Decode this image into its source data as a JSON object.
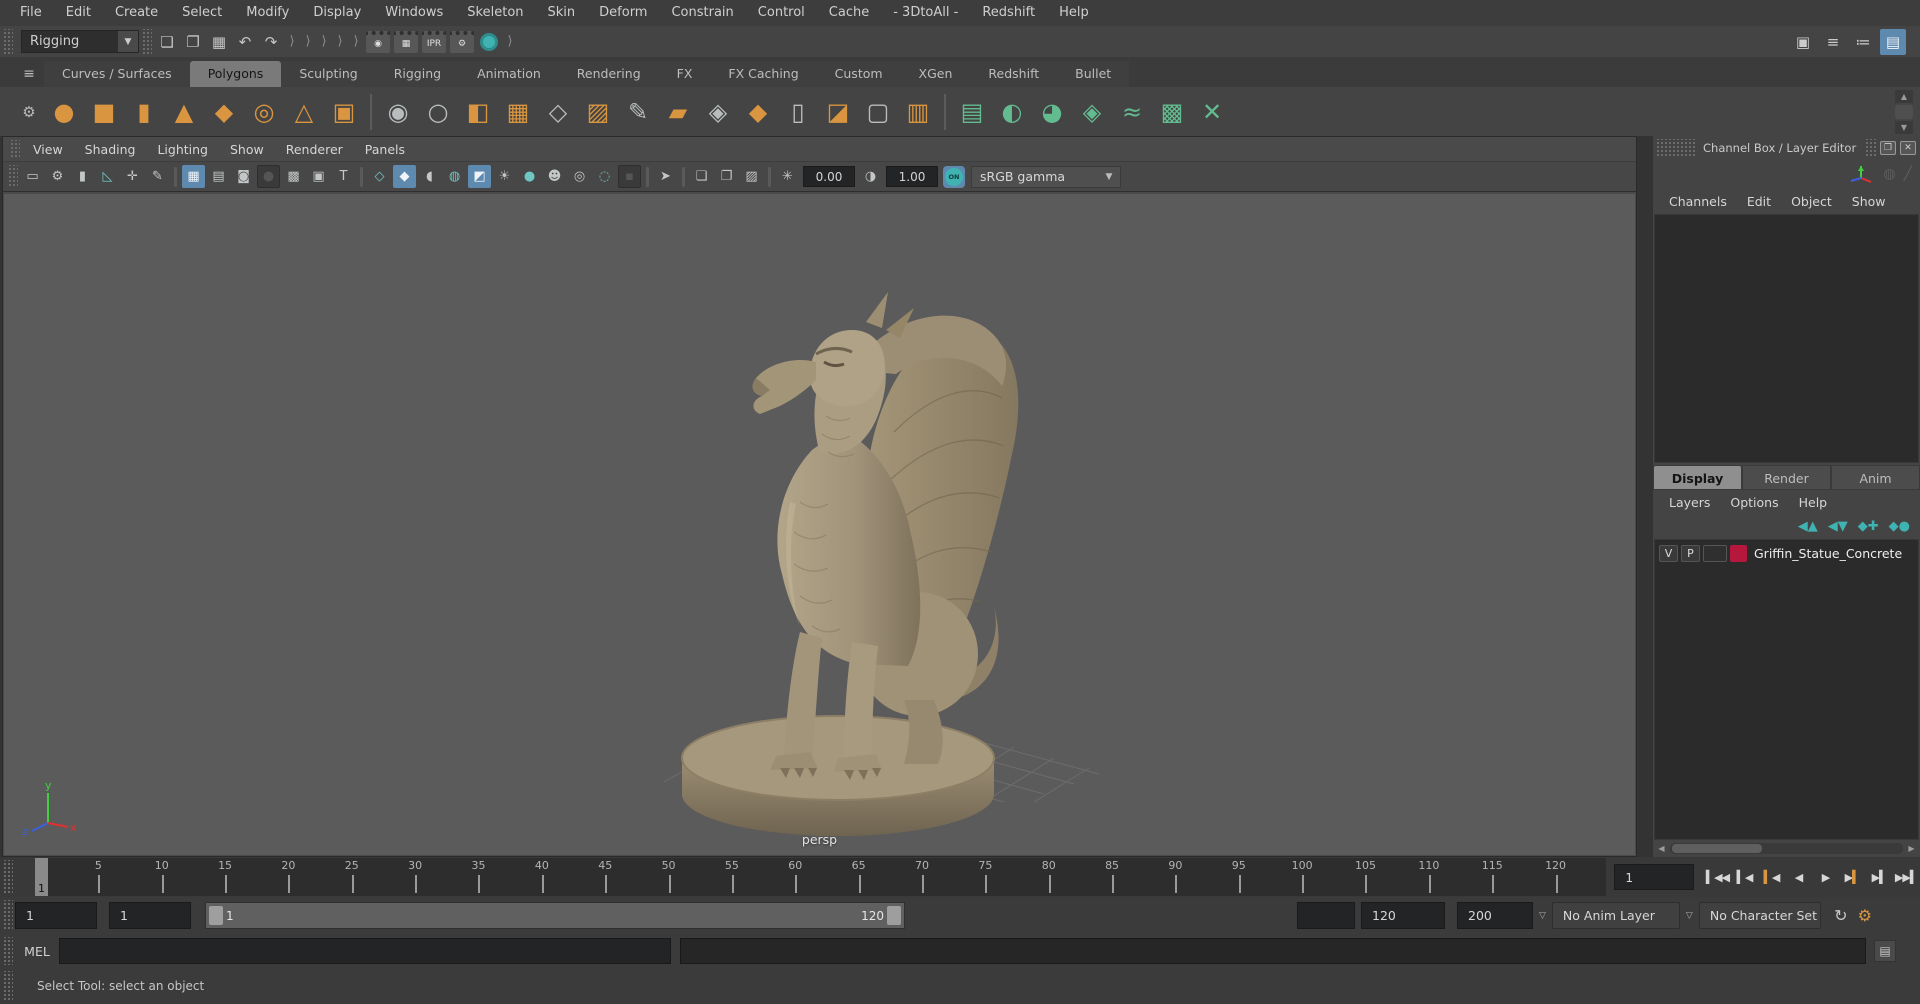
{
  "menu_bar": {
    "items": [
      {
        "name": "menu-file",
        "label": "File"
      },
      {
        "name": "menu-edit",
        "label": "Edit"
      },
      {
        "name": "menu-create",
        "label": "Create"
      },
      {
        "name": "menu-select",
        "label": "Select"
      },
      {
        "name": "menu-modify",
        "label": "Modify"
      },
      {
        "name": "menu-display",
        "label": "Display"
      },
      {
        "name": "menu-windows",
        "label": "Windows"
      },
      {
        "name": "menu-skeleton",
        "label": "Skeleton"
      },
      {
        "name": "menu-skin",
        "label": "Skin"
      },
      {
        "name": "menu-deform",
        "label": "Deform"
      },
      {
        "name": "menu-constrain",
        "label": "Constrain"
      },
      {
        "name": "menu-control",
        "label": "Control"
      },
      {
        "name": "menu-cache",
        "label": "Cache"
      },
      {
        "name": "menu-3dtoall",
        "label": "- 3DtoAll -"
      },
      {
        "name": "menu-redshift",
        "label": "Redshift"
      },
      {
        "name": "menu-help",
        "label": "Help"
      }
    ]
  },
  "status_line": {
    "menu_set": "Rigging",
    "menu_set_arrow": "▼",
    "file_icons": [
      {
        "name": "new-scene-icon",
        "glyph": "❏"
      },
      {
        "name": "open-scene-icon",
        "glyph": "❐"
      },
      {
        "name": "save-scene-icon",
        "glyph": "▦"
      },
      {
        "name": "undo-icon",
        "glyph": "↶"
      },
      {
        "name": "redo-icon",
        "glyph": "↷"
      }
    ],
    "collapsed_sections": [
      {
        "name": "collapsed-section-snap",
        "glyph": "⟩"
      },
      {
        "name": "collapsed-section-symmetry",
        "glyph": "⟩"
      },
      {
        "name": "collapsed-section-inputs",
        "glyph": "⟩"
      },
      {
        "name": "collapsed-section-construction",
        "glyph": "⟩"
      },
      {
        "name": "collapsed-section-history",
        "glyph": "⟩"
      }
    ],
    "render_icons": [
      {
        "name": "open-render-view-icon",
        "glyph": "◉"
      },
      {
        "name": "render-current-frame-icon",
        "glyph": "▦"
      },
      {
        "name": "ipr-render-icon",
        "glyph": "IPR"
      },
      {
        "name": "render-settings-icon",
        "glyph": "⚙"
      }
    ],
    "sidebar_toggles": [
      {
        "name": "modeling-toolkit-toggle",
        "glyph": "▣"
      },
      {
        "name": "attribute-editor-toggle",
        "glyph": "≡"
      },
      {
        "name": "tool-settings-toggle",
        "glyph": "≔"
      },
      {
        "name": "channel-box-toggle",
        "glyph": "▤",
        "active": true
      }
    ]
  },
  "shelf": {
    "tabs": [
      {
        "name": "shelf-tab-curves-surfaces",
        "label": "Curves / Surfaces"
      },
      {
        "name": "shelf-tab-polygons",
        "label": "Polygons",
        "active": true
      },
      {
        "name": "shelf-tab-sculpting",
        "label": "Sculpting"
      },
      {
        "name": "shelf-tab-rigging",
        "label": "Rigging"
      },
      {
        "name": "shelf-tab-animation",
        "label": "Animation"
      },
      {
        "name": "shelf-tab-rendering",
        "label": "Rendering"
      },
      {
        "name": "shelf-tab-fx",
        "label": "FX"
      },
      {
        "name": "shelf-tab-fx-caching",
        "label": "FX Caching"
      },
      {
        "name": "shelf-tab-custom",
        "label": "Custom"
      },
      {
        "name": "shelf-tab-xgen",
        "label": "XGen"
      },
      {
        "name": "shelf-tab-redshift",
        "label": "Redshift"
      },
      {
        "name": "shelf-tab-bullet",
        "label": "Bullet"
      }
    ],
    "primitives": [
      {
        "name": "poly-sphere-icon",
        "glyph": "●",
        "cls": "orange"
      },
      {
        "name": "poly-cube-icon",
        "glyph": "■",
        "cls": "orange"
      },
      {
        "name": "poly-cylinder-icon",
        "glyph": "▮",
        "cls": "orange"
      },
      {
        "name": "poly-cone-icon",
        "glyph": "▲",
        "cls": "orange"
      },
      {
        "name": "poly-plane-icon",
        "glyph": "◆",
        "cls": "orange"
      },
      {
        "name": "poly-torus-icon",
        "glyph": "◎",
        "cls": "orange"
      },
      {
        "name": "poly-pyramid-icon",
        "glyph": "△",
        "cls": "orange"
      },
      {
        "name": "poly-pipe-icon",
        "glyph": "▣",
        "cls": "orange"
      }
    ],
    "modeling": [
      {
        "name": "combine-icon",
        "glyph": "◉",
        "cls": "gray"
      },
      {
        "name": "separate-icon",
        "glyph": "○",
        "cls": "gray"
      },
      {
        "name": "mirror-icon",
        "glyph": "◧",
        "cls": "orange"
      },
      {
        "name": "smooth-icon",
        "glyph": "▦",
        "cls": "orange"
      },
      {
        "name": "smooth-mesh-preview-icon",
        "glyph": "◇",
        "cls": "gray"
      },
      {
        "name": "reduce-icon",
        "glyph": "▨",
        "cls": "orange"
      },
      {
        "name": "multi-cut-icon",
        "glyph": "✎",
        "cls": "gray"
      },
      {
        "name": "extrude-icon",
        "glyph": "▰",
        "cls": "orange"
      },
      {
        "name": "bevel-icon",
        "glyph": "◈",
        "cls": "gray"
      },
      {
        "name": "bridge-icon",
        "glyph": "◆",
        "cls": "orange"
      },
      {
        "name": "target-weld-icon",
        "glyph": "▯",
        "cls": "gray"
      },
      {
        "name": "quad-draw-icon",
        "glyph": "◪",
        "cls": "orange"
      },
      {
        "name": "edit-edge-flow-icon",
        "glyph": "▢",
        "cls": "gray"
      },
      {
        "name": "insert-edge-loop-icon",
        "glyph": "▥",
        "cls": "orange"
      }
    ],
    "uv": [
      {
        "name": "planar-mapping-icon",
        "glyph": "▤",
        "cls": "green"
      },
      {
        "name": "cylindrical-mapping-icon",
        "glyph": "◐",
        "cls": "green"
      },
      {
        "name": "spherical-mapping-icon",
        "glyph": "◕",
        "cls": "green"
      },
      {
        "name": "automatic-mapping-icon",
        "glyph": "◈",
        "cls": "green"
      },
      {
        "name": "contour-stretch-icon",
        "glyph": "≈",
        "cls": "green"
      },
      {
        "name": "uv-editor-icon",
        "glyph": "▩",
        "cls": "green"
      },
      {
        "name": "unfold-icon",
        "glyph": "✕",
        "cls": "green"
      }
    ]
  },
  "viewport": {
    "menus": [
      {
        "name": "vp-menu-view",
        "label": "View"
      },
      {
        "name": "vp-menu-shading",
        "label": "Shading"
      },
      {
        "name": "vp-menu-lighting",
        "label": "Lighting"
      },
      {
        "name": "vp-menu-show",
        "label": "Show"
      },
      {
        "name": "vp-menu-renderer",
        "label": "Renderer"
      },
      {
        "name": "vp-menu-panels",
        "label": "Panels"
      }
    ],
    "toolbar_g1": [
      {
        "name": "select-camera-icon",
        "glyph": "▭"
      },
      {
        "name": "camera-attributes-icon",
        "glyph": "⚙"
      },
      {
        "name": "bookmark-icon",
        "glyph": "▮"
      },
      {
        "name": "image-plane-icon",
        "glyph": "◺",
        "cls": "teal"
      },
      {
        "name": "pan-zoom-icon",
        "glyph": "✛"
      },
      {
        "name": "grease-pencil-icon",
        "glyph": "✎"
      }
    ],
    "toolbar_g2": [
      {
        "name": "grid-toggle-icon",
        "glyph": "▦",
        "active": true
      },
      {
        "name": "film-gate-icon",
        "glyph": "▤"
      },
      {
        "name": "resolution-gate-icon",
        "glyph": "◙"
      },
      {
        "name": "gate-mask-icon",
        "glyph": "●",
        "cls": "dark"
      },
      {
        "name": "field-chart-icon",
        "glyph": "▩"
      },
      {
        "name": "safe-action-icon",
        "glyph": "▣"
      },
      {
        "name": "safe-title-icon",
        "glyph": "T"
      }
    ],
    "toolbar_g3": [
      {
        "name": "wireframe-icon",
        "glyph": "◇",
        "cls": "teal"
      },
      {
        "name": "smooth-shade-icon",
        "glyph": "◆",
        "active": true
      },
      {
        "name": "flat-shade-icon",
        "glyph": "◖"
      },
      {
        "name": "textured-icon",
        "glyph": "◍",
        "cls": "teal"
      },
      {
        "name": "use-default-material-icon",
        "glyph": "◩",
        "active": true
      },
      {
        "name": "lights-icon",
        "glyph": "☀"
      },
      {
        "name": "shadows-icon",
        "glyph": "●",
        "cls": "teal"
      }
    ],
    "toolbar_g4": [
      {
        "name": "xray-icon",
        "glyph": "☻"
      },
      {
        "name": "xray-joints-icon",
        "glyph": "◎"
      },
      {
        "name": "xray-active-icon",
        "glyph": "◌",
        "cls": "teal"
      },
      {
        "name": "isolate-select-icon",
        "glyph": "▪",
        "cls": "dark"
      }
    ],
    "toolbar_g5": [
      {
        "name": "select-object-icon",
        "glyph": "➤"
      }
    ],
    "toolbar_g6": [
      {
        "name": "snapshot-copy-icon",
        "glyph": "❏"
      },
      {
        "name": "snapshot-paste-icon",
        "glyph": "❐"
      },
      {
        "name": "viewport-snapshot-icon",
        "glyph": "▨"
      }
    ],
    "exposure_icon": "✳",
    "exposure_value": "0.00",
    "gamma_icon": "◑",
    "gamma_value": "1.00",
    "on_label": "ON",
    "view_transform": "sRGB gamma",
    "view_transform_arrow": "▼",
    "camera_label": "persp",
    "axis_labels": {
      "x": "x",
      "y": "y",
      "z": "z"
    }
  },
  "channel_box": {
    "title": "Channel Box / Layer Editor",
    "float_glyph": "❐",
    "close_glyph": "✕",
    "menus": [
      {
        "name": "cb-menu-channels",
        "label": "Channels"
      },
      {
        "name": "cb-menu-edit",
        "label": "Edit"
      },
      {
        "name": "cb-menu-object",
        "label": "Object"
      },
      {
        "name": "cb-menu-show",
        "label": "Show"
      }
    ]
  },
  "layer_editor": {
    "tabs": [
      {
        "name": "layer-tab-display",
        "label": "Display",
        "active": true
      },
      {
        "name": "layer-tab-render",
        "label": "Render"
      },
      {
        "name": "layer-tab-anim",
        "label": "Anim"
      }
    ],
    "menus": [
      {
        "name": "layer-menu-layers",
        "label": "Layers"
      },
      {
        "name": "layer-menu-options",
        "label": "Options"
      },
      {
        "name": "layer-menu-help",
        "label": "Help"
      }
    ],
    "actions": [
      {
        "name": "move-layer-up-icon",
        "glyph": "◀▲"
      },
      {
        "name": "move-layer-down-icon",
        "glyph": "◀▼"
      },
      {
        "name": "create-empty-layer-icon",
        "glyph": "◆✚"
      },
      {
        "name": "create-layer-from-selected-icon",
        "glyph": "◆●"
      }
    ],
    "layers": [
      {
        "visible": "V",
        "playback": "P",
        "color": "#b5173d",
        "label": "Griffin_Statue_Concrete"
      }
    ],
    "hscroll": {
      "left": "◀",
      "right": "▶"
    }
  },
  "timeline": {
    "tick_labels": [
      5,
      10,
      15,
      20,
      25,
      30,
      35,
      40,
      45,
      50,
      55,
      60,
      65,
      70,
      75,
      80,
      85,
      90,
      95,
      100,
      105,
      110,
      115,
      120
    ],
    "view_end": 124,
    "playhead_frame": 1,
    "playhead_label": "1",
    "current_frame_field": "1",
    "playback": [
      {
        "name": "go-to-start-button",
        "pre": "▍",
        "tri": "◀◀",
        "post": ""
      },
      {
        "name": "step-back-frame-button",
        "pre": "▍",
        "tri": "◀",
        "post": ""
      },
      {
        "name": "step-back-key-button",
        "pre": "▍",
        "tri": "◀",
        "post": "",
        "accent": true
      },
      {
        "name": "play-backwards-button",
        "pre": "",
        "tri": "◀",
        "post": ""
      },
      {
        "name": "play-forwards-button",
        "pre": "",
        "tri": "▶",
        "post": ""
      },
      {
        "name": "step-forward-key-button",
        "pre": "",
        "tri": "▶",
        "post": "▍",
        "accent": true
      },
      {
        "name": "step-forward-frame-button",
        "pre": "",
        "tri": "▶",
        "post": "▍"
      },
      {
        "name": "go-to-end-button",
        "pre": "",
        "tri": "▶▶",
        "post": "▍"
      }
    ]
  },
  "range_slider": {
    "anim_start": "1",
    "playback_start": "1",
    "range_start_label": "1",
    "range_end_label": "120",
    "playback_end": "120",
    "anim_end": "200",
    "dd_arrow": "▽",
    "anim_layer": "No Anim Layer",
    "character_set": "No Character Set",
    "autokey_glyph": "↻",
    "prefs_glyph": "⚙"
  },
  "command_line": {
    "label": "MEL",
    "script_editor_glyph": "▤"
  },
  "help_line": {
    "text": "Select Tool: select an object"
  }
}
